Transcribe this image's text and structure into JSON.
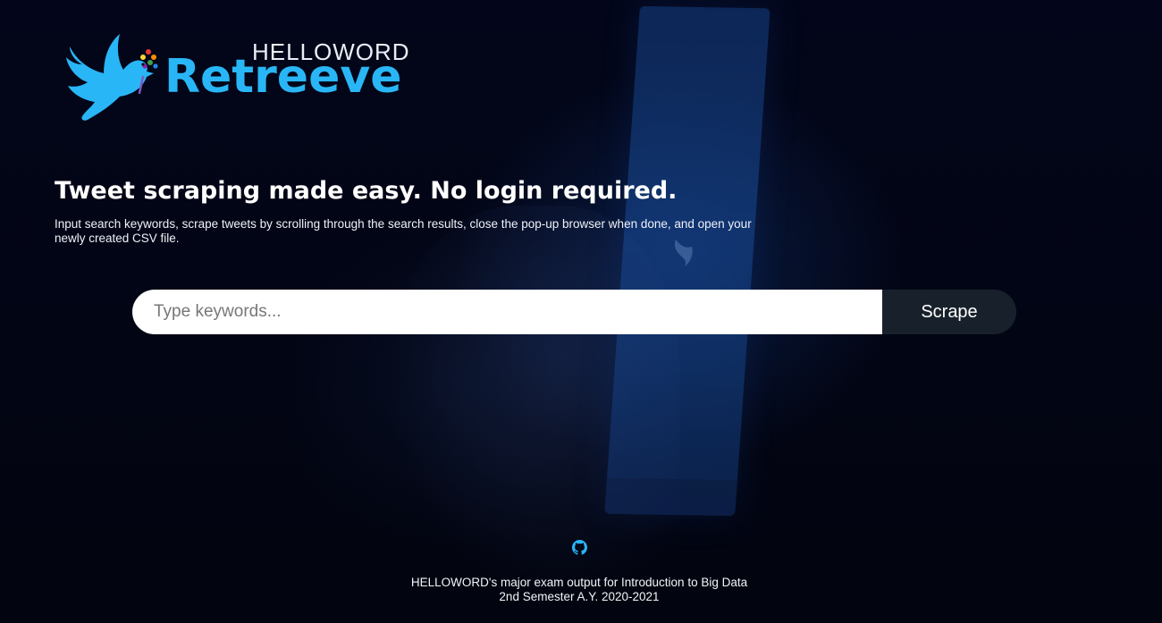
{
  "logo": {
    "brand_top": "HELLOWORD",
    "brand_main": "Retreeve",
    "accent_color": "#29b6f6"
  },
  "hero": {
    "headline": "Tweet scraping made easy. No login required.",
    "subtext": "Input search keywords, scrape tweets by scrolling through the search results, close the pop-up browser when done, and open your newly created CSV file."
  },
  "search": {
    "placeholder": "Type keywords...",
    "value": "",
    "button_label": "Scrape"
  },
  "footer": {
    "icon": "github-icon",
    "line1": "HELLOWORD's major exam output for Introduction to Big Data",
    "line2": "2nd Semester A.Y. 2020-2021"
  }
}
